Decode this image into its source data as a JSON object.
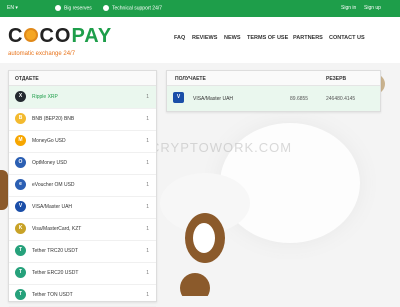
{
  "topbar": {
    "lang": "EN",
    "reserves": "Big reserves",
    "support": "Technical support 24/7",
    "signin": "Sign in",
    "signup": "Sign up"
  },
  "brand": {
    "logo_left": "C",
    "logo_mid": "CO",
    "logo_right": "PAY",
    "tagline": "automatic exchange 24/7"
  },
  "nav": [
    "FAQ",
    "REVIEWS",
    "NEWS",
    "TERMS OF USE",
    "PARTNERS",
    "CONTACT US"
  ],
  "give": {
    "header": "ОТДАЕТЕ",
    "items": [
      {
        "label": "Ripple XRP",
        "count": "1",
        "color": "#23292f",
        "glyph": "X"
      },
      {
        "label": "BNB (BEP20) BNB",
        "count": "1",
        "color": "#f3ba2f",
        "glyph": "B"
      },
      {
        "label": "MoneyGo USD",
        "count": "1",
        "color": "#f7a600",
        "glyph": "M"
      },
      {
        "label": "OptMoney USD",
        "count": "1",
        "color": "#2b5fb3",
        "glyph": "O"
      },
      {
        "label": "eVoucher OM USD",
        "count": "1",
        "color": "#2b5fb3",
        "glyph": "e"
      },
      {
        "label": "VISA/Master UAH",
        "count": "1",
        "color": "#1a4ea8",
        "glyph": "V"
      },
      {
        "label": "Visa/MasterCard, KZT",
        "count": "1",
        "color": "#c8a227",
        "glyph": "K"
      },
      {
        "label": "Tether TRC20 USDT",
        "count": "1",
        "color": "#26a17b",
        "glyph": "T"
      },
      {
        "label": "Tether ERC20 USDT",
        "count": "1",
        "color": "#26a17b",
        "glyph": "T"
      },
      {
        "label": "Tether TON USDT",
        "count": "1",
        "color": "#26a17b",
        "glyph": "T"
      }
    ]
  },
  "receive": {
    "header": "ПОЛУЧАЕТЕ",
    "reserve_header": "РЕЗЕРВ",
    "items": [
      {
        "label": "VISA/Master UAH",
        "rate": "89.6855",
        "reserve": "246480.4145"
      }
    ]
  },
  "watermark": "CRYPTOWORK.COM"
}
